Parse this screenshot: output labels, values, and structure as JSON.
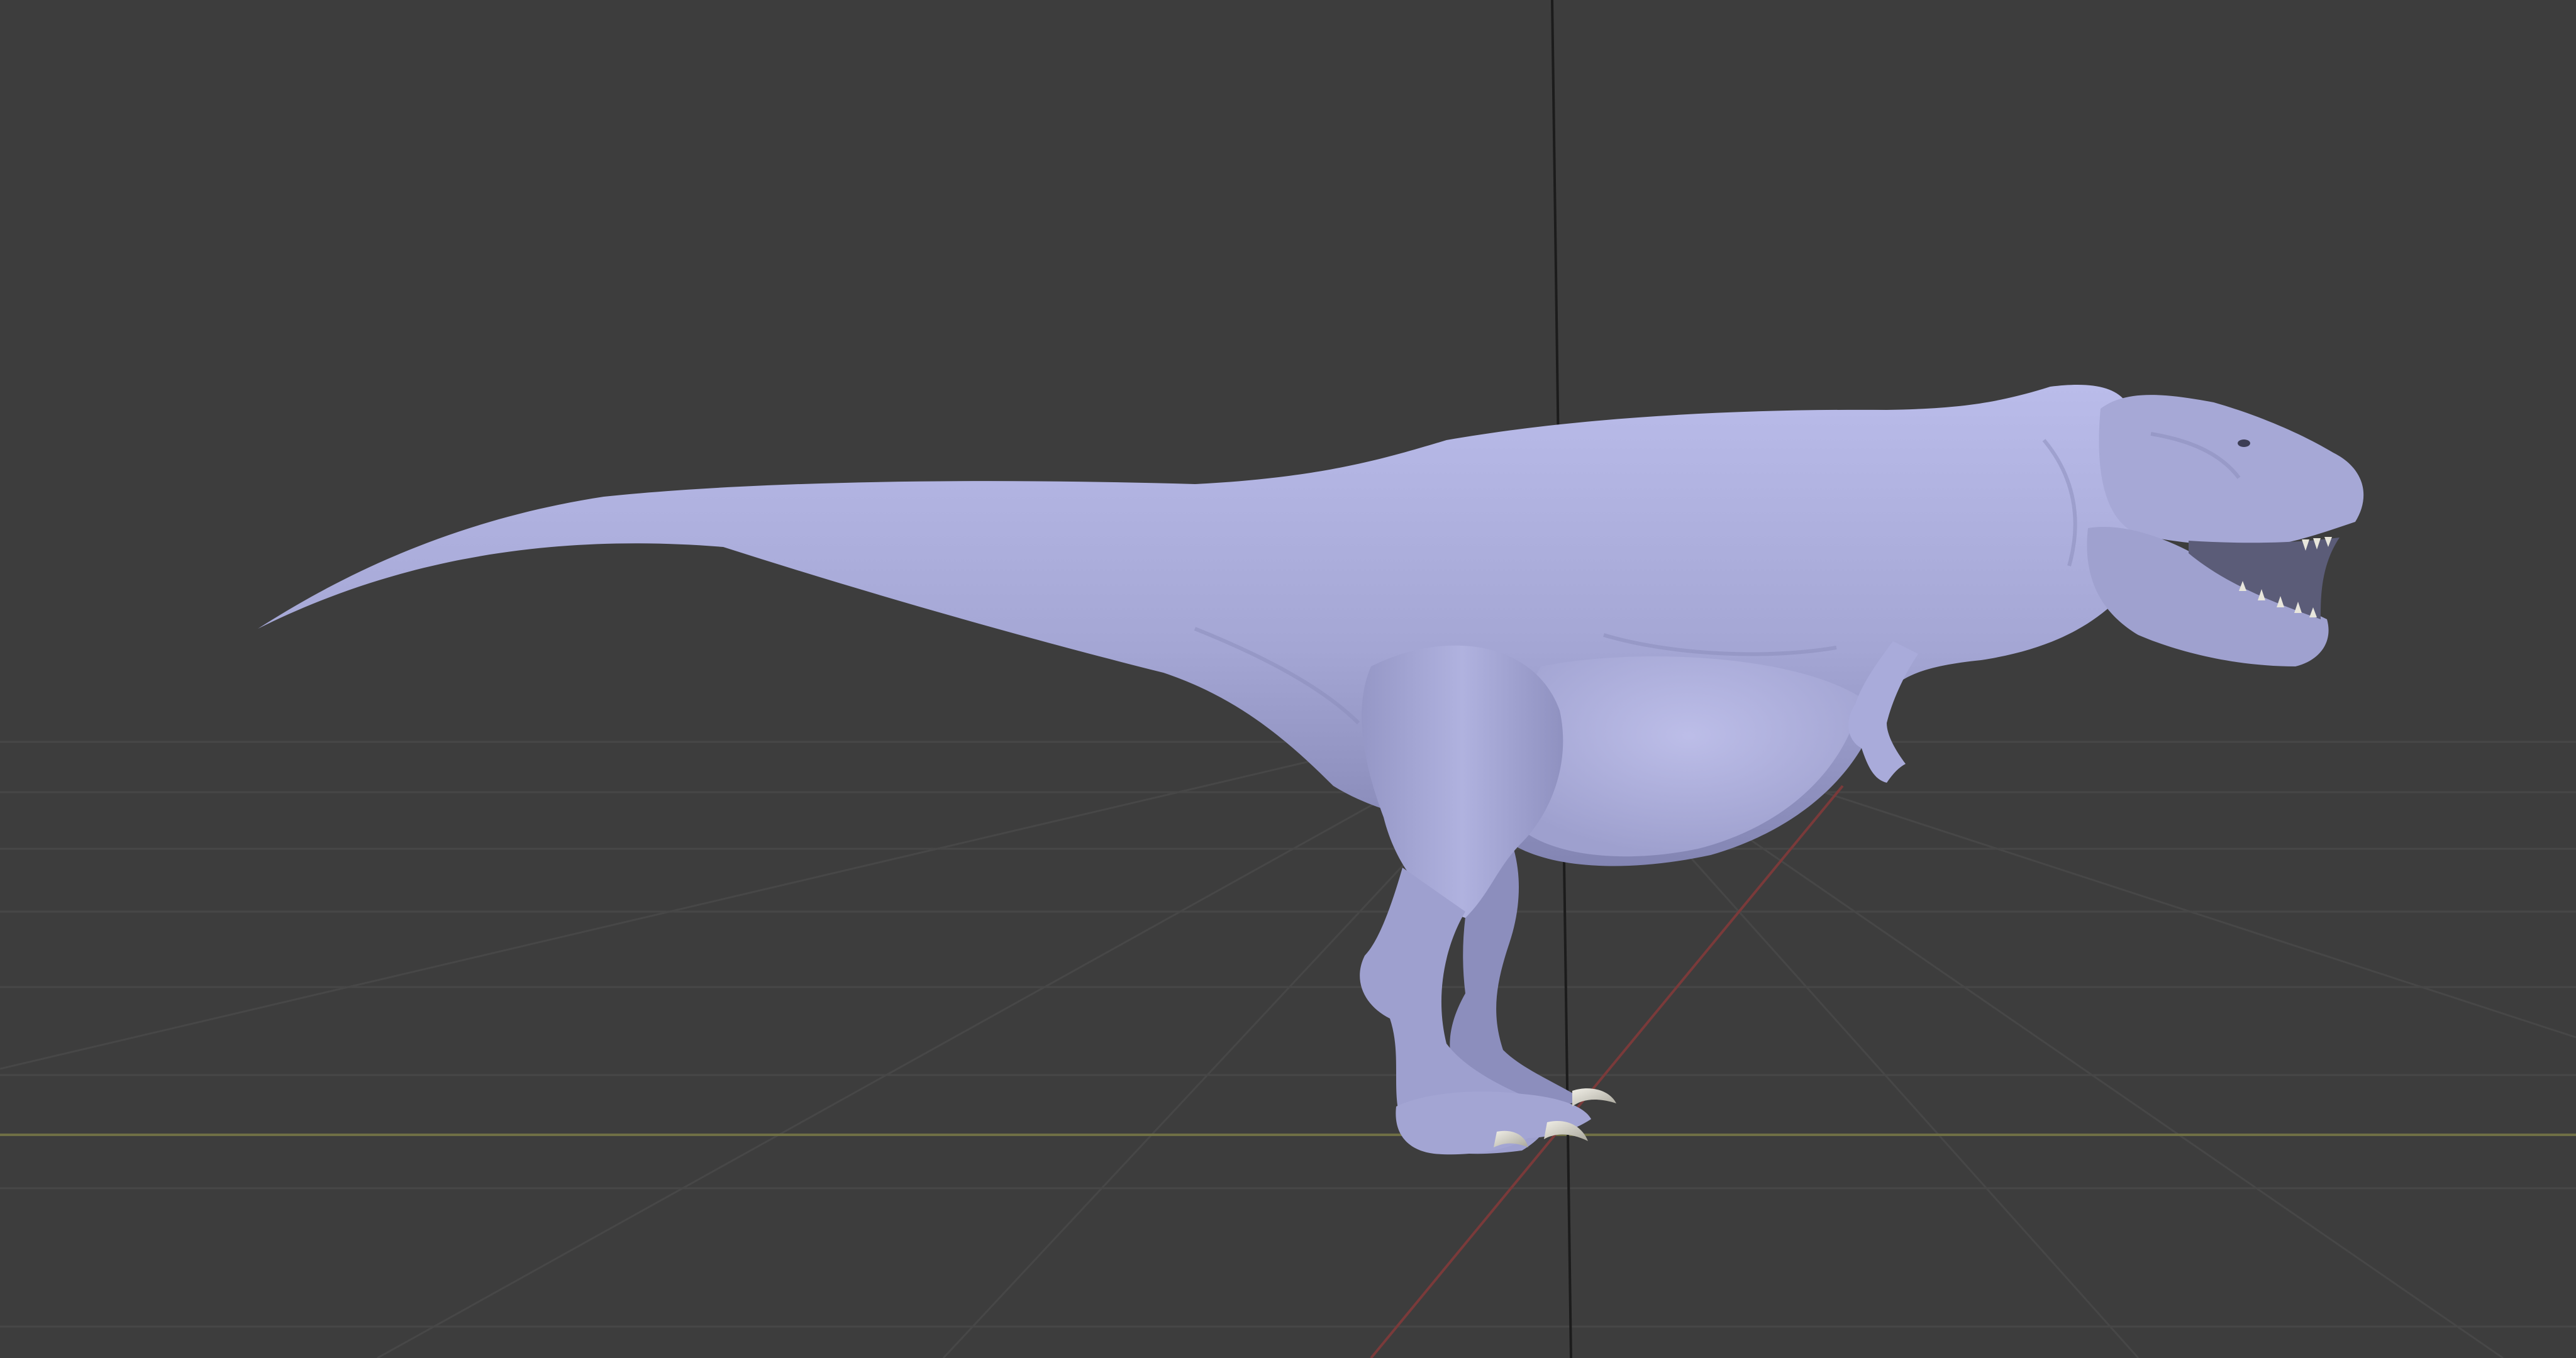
{
  "viewport": {
    "background_color": "#3d3d3d",
    "grid_color": "#4a4a4a",
    "x_axis_color": "#7a7a46",
    "y_axis_color": "#8a3a3a",
    "z_axis_color": "#1e1e1e"
  },
  "model": {
    "name_icon": "tyrannosaurus-sculpt",
    "body_color": "#a7a9d6",
    "shadow_color": "#6f7196",
    "highlight_color": "#c9caf0",
    "claw_color": "#d6d4c8",
    "teeth_color": "#e8e6dc"
  }
}
